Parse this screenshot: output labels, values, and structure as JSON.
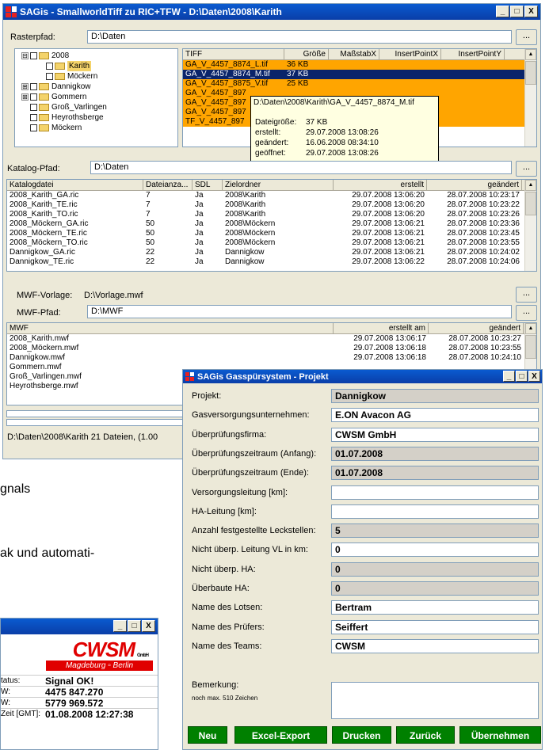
{
  "main": {
    "title": "SAGis - SmallworldTiff zu RIC+TFW - D:\\Daten\\2008\\Karith",
    "controls": {
      "min": "_",
      "max": "□",
      "close": "X"
    },
    "raster_label": "Rasterpfad:",
    "raster_path": "D:\\Daten",
    "browse": "...",
    "tree": [
      {
        "label": "2008",
        "exp": "⊟"
      },
      {
        "label": "Karith",
        "exp": ""
      },
      {
        "label": "Möckern",
        "exp": ""
      },
      {
        "label": "Dannigkow",
        "exp": "⊞"
      },
      {
        "label": "Gommern",
        "exp": "⊞"
      },
      {
        "label": "Groß_Varlingen",
        "exp": ""
      },
      {
        "label": "Heyrothsberge",
        "exp": ""
      },
      {
        "label": "Möckern",
        "exp": ""
      }
    ],
    "tiff_headers": [
      "TIFF",
      "Größe",
      "MaßstabX",
      "InsertPointX",
      "InsertPointY"
    ],
    "tiff_rows": [
      {
        "name": "GA_V_4457_8874_L.tif",
        "size": "36 KB"
      },
      {
        "name": "GA_V_4457_8874_M.tif",
        "size": "37 KB"
      },
      {
        "name": "GA_V_4457_8875_V.tif",
        "size": "25 KB"
      },
      {
        "name": "GA_V_4457_897",
        "size": ""
      },
      {
        "name": "GA_V_4457_897",
        "size": ""
      },
      {
        "name": "GA_V_4457_897",
        "size": ""
      },
      {
        "name": "TF_V_4457_897",
        "size": ""
      }
    ],
    "tooltip": {
      "path": "D:\\Daten\\2008\\Karith\\GA_V_4457_8874_M.tif",
      "rows": [
        [
          "Dateigröße:",
          "37 KB"
        ],
        [
          "erstellt:",
          "29.07.2008 13:08:26"
        ],
        [
          "geändert:",
          "16.06.2008 08:34:10"
        ],
        [
          "geöffnet:",
          "29.07.2008 13:08:26"
        ]
      ]
    },
    "katalog_label": "Katalog-Pfad:",
    "katalog_path": "D:\\Daten",
    "cat_headers": [
      "Katalogdatei",
      "Dateianza...",
      "SDL",
      "Zielordner",
      "erstellt",
      "geändert"
    ],
    "cat_rows": [
      [
        "2008_Karith_GA.ric",
        "7",
        "Ja",
        "2008\\Karith",
        "29.07.2008 13:06:20",
        "28.07.2008 10:23:17"
      ],
      [
        "2008_Karith_TE.ric",
        "7",
        "Ja",
        "2008\\Karith",
        "29.07.2008 13:06:20",
        "28.07.2008 10:23:22"
      ],
      [
        "2008_Karith_TO.ric",
        "7",
        "Ja",
        "2008\\Karith",
        "29.07.2008 13:06:20",
        "28.07.2008 10:23:26"
      ],
      [
        "2008_Möckern_GA.ric",
        "50",
        "Ja",
        "2008\\Möckern",
        "29.07.2008 13:06:21",
        "28.07.2008 10:23:36"
      ],
      [
        "2008_Möckern_TE.ric",
        "50",
        "Ja",
        "2008\\Möckern",
        "29.07.2008 13:06:21",
        "28.07.2008 10:23:45"
      ],
      [
        "2008_Möckern_TO.ric",
        "50",
        "Ja",
        "2008\\Möckern",
        "29.07.2008 13:06:21",
        "28.07.2008 10:23:55"
      ],
      [
        "Dannigkow_GA.ric",
        "22",
        "Ja",
        "Dannigkow",
        "29.07.2008 13:06:21",
        "28.07.2008 10:24:02"
      ],
      [
        "Dannigkow_TE.ric",
        "22",
        "Ja",
        "Dannigkow",
        "29.07.2008 13:06:22",
        "28.07.2008 10:24:06"
      ]
    ],
    "mwf_vorlage_label": "MWF-Vorlage:",
    "mwf_vorlage": "D:\\Vorlage.mwf",
    "mwf_pfad_label": "MWF-Pfad:",
    "mwf_pfad": "D:\\MWF",
    "mwf_headers": [
      "MWF",
      "erstellt am",
      "geändert"
    ],
    "mwf_rows": [
      [
        "2008_Karith.mwf",
        "29.07.2008 13:06:17",
        "28.07.2008 10:23:27"
      ],
      [
        "2008_Möckern.mwf",
        "29.07.2008 13:06:18",
        "28.07.2008 10:23:55"
      ],
      [
        "Dannigkow.mwf",
        "29.07.2008 13:06:18",
        "28.07.2008 10:24:10"
      ],
      [
        "Gommern.mwf",
        "",
        ""
      ],
      [
        "Groß_Varlingen.mwf",
        "",
        ""
      ],
      [
        "Heyrothsberge.mwf",
        "",
        ""
      ]
    ],
    "status": "D:\\Daten\\2008\\Karith   21 Dateien, (1.00"
  },
  "doc": {
    "line1": "gnals",
    "line2": "ak und automati-"
  },
  "cwsm": {
    "logo": "CWSM",
    "gmbh": "GmbH",
    "tagline": "Magdeburg ▫ Berlin",
    "rows": [
      [
        "tatus:",
        "Signal OK!"
      ],
      [
        "W:",
        "4475 847.270"
      ],
      [
        "W:",
        "5779 969.572"
      ],
      [
        "Zeit [GMT]:",
        "01.08.2008 12:27:38"
      ]
    ]
  },
  "projekt": {
    "title": "SAGis Gasspürsystem - Projekt",
    "fields": [
      {
        "label": "Projekt:",
        "value": "Dannigkow",
        "style": "g"
      },
      {
        "label": "Gasversorgungsunternehmen:",
        "value": "E.ON Avacon AG",
        "style": "w2"
      },
      {
        "label": "Überprüfungsfirma:",
        "value": "CWSM GmbH",
        "style": "w2"
      },
      {
        "label": "Überprüfungszeitraum (Anfang):",
        "value": "01.07.2008",
        "style": "g"
      },
      {
        "label": "Überprüfungszeitraum (Ende):",
        "value": "01.07.2008",
        "style": "g"
      },
      {
        "label": "Versorgungsleitung [km]:",
        "value": "",
        "style": "w"
      },
      {
        "label": "HA-Leitung [km]:",
        "value": "",
        "style": "w"
      },
      {
        "label": "Anzahl festgestellte Leckstellen:",
        "value": "5",
        "style": "g"
      },
      {
        "label": "Nicht überp. Leitung VL in km:",
        "value": "0",
        "style": "w2"
      },
      {
        "label": "Nicht überp. HA:",
        "value": "0",
        "style": "g"
      },
      {
        "label": "Überbaute HA:",
        "value": "0",
        "style": "g"
      },
      {
        "label": "Name des Lotsen:",
        "value": "Bertram",
        "style": "w2"
      },
      {
        "label": "Name des Prüfers:",
        "value": "Seiffert",
        "style": "w2"
      },
      {
        "label": "Name des Teams:",
        "value": "CWSM",
        "style": "w2"
      }
    ],
    "bemerkung_label": "Bemerkung:",
    "bemerkung_hint": "noch max. 510 Zeichen",
    "buttons": [
      "Neu",
      "Excel-Export",
      "Drucken",
      "Zurück",
      "Übernehmen"
    ]
  }
}
